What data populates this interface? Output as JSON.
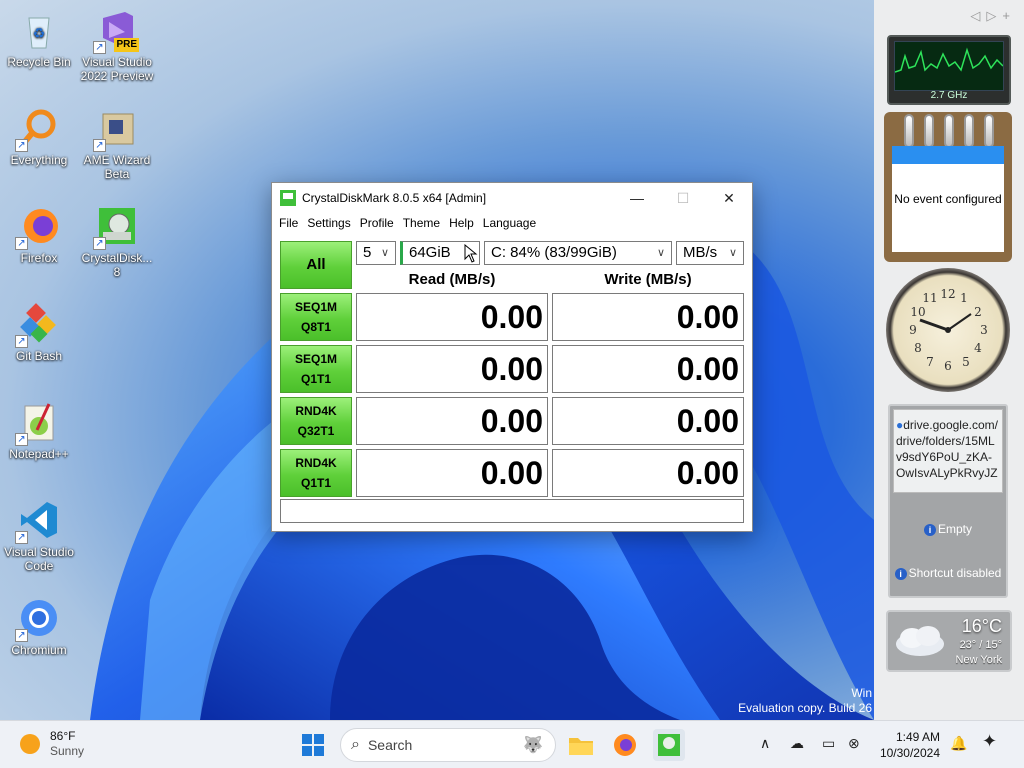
{
  "desktop": {
    "icons": [
      {
        "label": "Recycle Bin",
        "icon": "recycle-bin-icon"
      },
      {
        "label": "Visual Studio 2022 Preview",
        "icon": "visual-studio-icon",
        "badge": "PRE"
      },
      {
        "label": "Everything",
        "icon": "everything-search-icon"
      },
      {
        "label": "AME Wizard Beta",
        "icon": "ame-wizard-icon"
      },
      {
        "label": "Firefox",
        "icon": "firefox-icon"
      },
      {
        "label": "CrystalDisk... 8",
        "icon": "crystaldiskmark-icon"
      },
      {
        "label": "Git Bash",
        "icon": "git-bash-icon"
      },
      {
        "label": "Notepad++",
        "icon": "notepadpp-icon"
      },
      {
        "label": "Visual Studio Code",
        "icon": "vscode-icon"
      },
      {
        "label": "Chromium",
        "icon": "chromium-icon"
      }
    ],
    "watermark": {
      "line1": "Win",
      "line2": "Evaluation copy. Build 26"
    }
  },
  "gadgets": {
    "cpu_label": "2.7 GHz",
    "calendar_text": "No event configured",
    "links": {
      "url": "drive.google.com/drive/folders/15MLv9sdY6PoU_zKA-OwIsvALyPkRvyJZ",
      "empty": "Empty",
      "shortcut": "Shortcut disabled"
    },
    "weather": {
      "temp": "16°C",
      "range": "23° / 15°",
      "city": "New York"
    }
  },
  "window": {
    "title": "CrystalDiskMark 8.0.5 x64 [Admin]",
    "menu": [
      "File",
      "Settings",
      "Profile",
      "Theme",
      "Help",
      "Language"
    ],
    "all_label": "All",
    "count": "5",
    "size": "64GiB",
    "drive": "C: 84% (83/99GiB)",
    "unit": "MB/s",
    "read_header": "Read (MB/s)",
    "write_header": "Write (MB/s)",
    "tests": [
      {
        "l1": "SEQ1M",
        "l2": "Q8T1",
        "read": "0.00",
        "write": "0.00"
      },
      {
        "l1": "SEQ1M",
        "l2": "Q1T1",
        "read": "0.00",
        "write": "0.00"
      },
      {
        "l1": "RND4K",
        "l2": "Q32T1",
        "read": "0.00",
        "write": "0.00"
      },
      {
        "l1": "RND4K",
        "l2": "Q1T1",
        "read": "0.00",
        "write": "0.00"
      }
    ],
    "comment": ""
  },
  "taskbar": {
    "weather_temp": "86°F",
    "weather_desc": "Sunny",
    "search_placeholder": "Search",
    "time": "1:49 AM",
    "date": "10/30/2024"
  }
}
